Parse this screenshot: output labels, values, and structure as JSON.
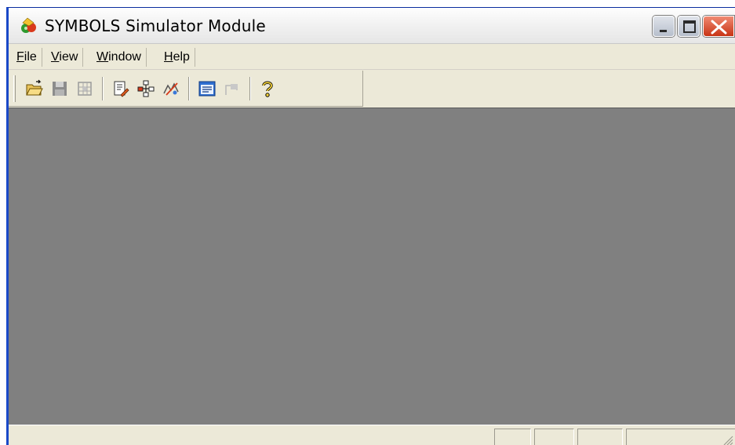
{
  "window": {
    "title": "SYMBOLS Simulator Module",
    "icon": "app-tool-icon"
  },
  "controls": {
    "minimize_icon": "minimize-icon",
    "maximize_icon": "maximize-icon",
    "close_icon": "close-icon"
  },
  "menubar": {
    "items": [
      {
        "mnemonic": "F",
        "rest": "ile"
      },
      {
        "mnemonic": "V",
        "rest": "iew"
      },
      {
        "mnemonic": "W",
        "rest": "indow"
      },
      {
        "mnemonic": "H",
        "rest": "elp"
      }
    ]
  },
  "toolbar": {
    "buttons": [
      {
        "icon": "open-folder-icon",
        "enabled": true
      },
      {
        "icon": "save-disk-icon",
        "enabled": false
      },
      {
        "icon": "grid-tool-icon",
        "enabled": false
      },
      {
        "icon": "edit-document-icon",
        "enabled": true
      },
      {
        "icon": "network-icon",
        "enabled": true
      },
      {
        "icon": "signal-tool-icon",
        "enabled": true
      },
      {
        "icon": "panel-window-icon",
        "enabled": true
      },
      {
        "icon": "flag-icon",
        "enabled": false
      },
      {
        "icon": "help-question-icon",
        "enabled": true
      }
    ]
  },
  "colors": {
    "client_background": "#808080",
    "chrome": "#ece9d8",
    "frame_blue": "#1a49c8",
    "close_red": "#c83415"
  },
  "statusbar": {
    "panes": [
      "",
      "",
      "",
      ""
    ]
  }
}
